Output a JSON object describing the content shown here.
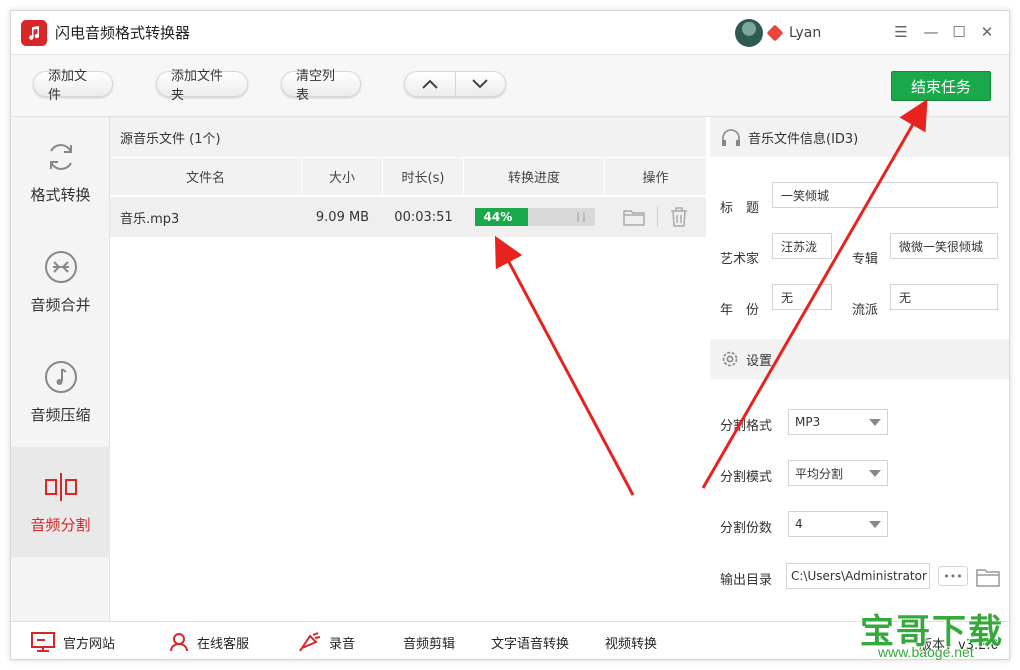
{
  "app": {
    "title": "闪电音频格式转换器",
    "user": "Lyan"
  },
  "window_controls": [
    "☰",
    "—",
    "☐",
    "✕"
  ],
  "toolbar": {
    "add_file": "添加文件",
    "add_folder": "添加文件夹",
    "clear_list": "清空列表",
    "end_task": "结束任务"
  },
  "sidebar": {
    "items": [
      {
        "label": "格式转换",
        "icon": "refresh-icon",
        "active": false
      },
      {
        "label": "音频合并",
        "icon": "merge-icon",
        "active": false
      },
      {
        "label": "音频压缩",
        "icon": "music-note-icon",
        "active": false
      },
      {
        "label": "音频分割",
        "icon": "split-icon",
        "active": true
      }
    ]
  },
  "filelist": {
    "header": "源音乐文件 (1个)",
    "columns": [
      "文件名",
      "大小",
      "时长(s)",
      "转换进度",
      "操作"
    ],
    "rows": [
      {
        "name": "音乐.mp3",
        "size": "9.09 MB",
        "duration": "00:03:51",
        "progress_label": "44%",
        "progress": 0.44
      }
    ]
  },
  "id3": {
    "section_title": "音乐文件信息(ID3)",
    "title_label": "标　题",
    "title_value": "一笑倾城",
    "artist_label": "艺术家",
    "artist_value": "汪苏泷",
    "album_label": "专辑",
    "album_value": "微微一笑很倾城",
    "year_label": "年　份",
    "year_value": "无",
    "genre_label": "流派",
    "genre_value": "无"
  },
  "settings": {
    "section_title": "设置",
    "format_label": "分割格式",
    "format_value": "MP3",
    "mode_label": "分割模式",
    "mode_value": "平均分割",
    "count_label": "分割份数",
    "count_value": "4",
    "output_label": "输出目录",
    "output_value": "C:\\Users\\Administrator",
    "more_label": "•••"
  },
  "bottombar": {
    "website": "官方网站",
    "support": "在线客服",
    "record": "录音",
    "audio_edit": "音频剪辑",
    "tts": "文字语音转换",
    "video": "视频转换",
    "version": "版本：v3.2.0"
  },
  "watermark": {
    "big": "宝哥下载",
    "small": "www.baoge.net"
  },
  "colors": {
    "accent_green": "#1aa84a",
    "brand_red": "#d8262b",
    "arrow_red": "#e8231f"
  }
}
